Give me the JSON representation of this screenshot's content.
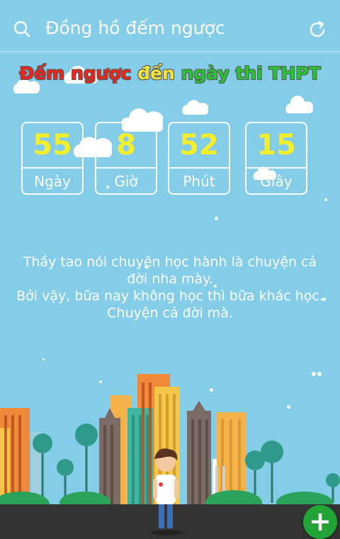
{
  "app_bar": {
    "title": "Đồng hồ đếm ngược",
    "search_icon": "search-icon",
    "refresh_icon": "refresh-icon"
  },
  "headline": {
    "part1": "Đếm ngược",
    "part2": "đến",
    "part3": "ngày thi THPT",
    "colors": {
      "part1": "#e8261c",
      "part2": "#f4e43a",
      "part3": "#2cc236"
    }
  },
  "countdown": [
    {
      "value": "55",
      "label": "Ngày"
    },
    {
      "value": "8",
      "label": "Giờ"
    },
    {
      "value": "52",
      "label": "Phút"
    },
    {
      "value": "15",
      "label": "Giây"
    }
  ],
  "quote": {
    "line1": "Thầy tao nói chuyện học hành là chuyện cả đời nha mày.",
    "line2": "Bởi vậy, bữa nay không học thì bữa khác học. Chuyện cả đời mà."
  },
  "fab": {
    "icon": "plus-icon",
    "color": "#21a336"
  },
  "colors": {
    "background": "#84cde9",
    "countdown_value": "#f5ee2b",
    "ground": "#333333"
  }
}
